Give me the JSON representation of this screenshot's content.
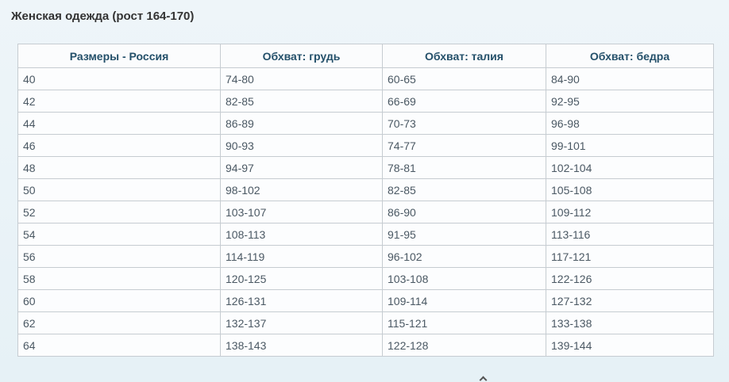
{
  "title": "Женская одежда (рост 164-170)",
  "table": {
    "headers": [
      "Размеры - Россия",
      "Обхват: грудь",
      "Обхват: талия",
      "Обхват: бедра"
    ],
    "rows": [
      [
        "40",
        "74-80",
        "60-65",
        "84-90"
      ],
      [
        "42",
        "82-85",
        "66-69",
        "92-95"
      ],
      [
        "44",
        "86-89",
        "70-73",
        "96-98"
      ],
      [
        "46",
        "90-93",
        "74-77",
        "99-101"
      ],
      [
        "48",
        "94-97",
        "78-81",
        "102-104"
      ],
      [
        "50",
        "98-102",
        "82-85",
        "105-108"
      ],
      [
        "52",
        "103-107",
        "86-90",
        "109-112"
      ],
      [
        "54",
        "108-113",
        "91-95",
        "113-116"
      ],
      [
        "56",
        "114-119",
        "96-102",
        "117-121"
      ],
      [
        "58",
        "120-125",
        "103-108",
        "122-126"
      ],
      [
        "60",
        "126-131",
        "109-114",
        "127-132"
      ],
      [
        "62",
        "132-137",
        "115-121",
        "133-138"
      ],
      [
        "64",
        "138-143",
        "122-128",
        "139-144"
      ]
    ]
  },
  "colors": {
    "background": "#eaf3f7",
    "header_text": "#24506a",
    "cell_text": "#4a5863",
    "border": "#c6ccd1"
  }
}
